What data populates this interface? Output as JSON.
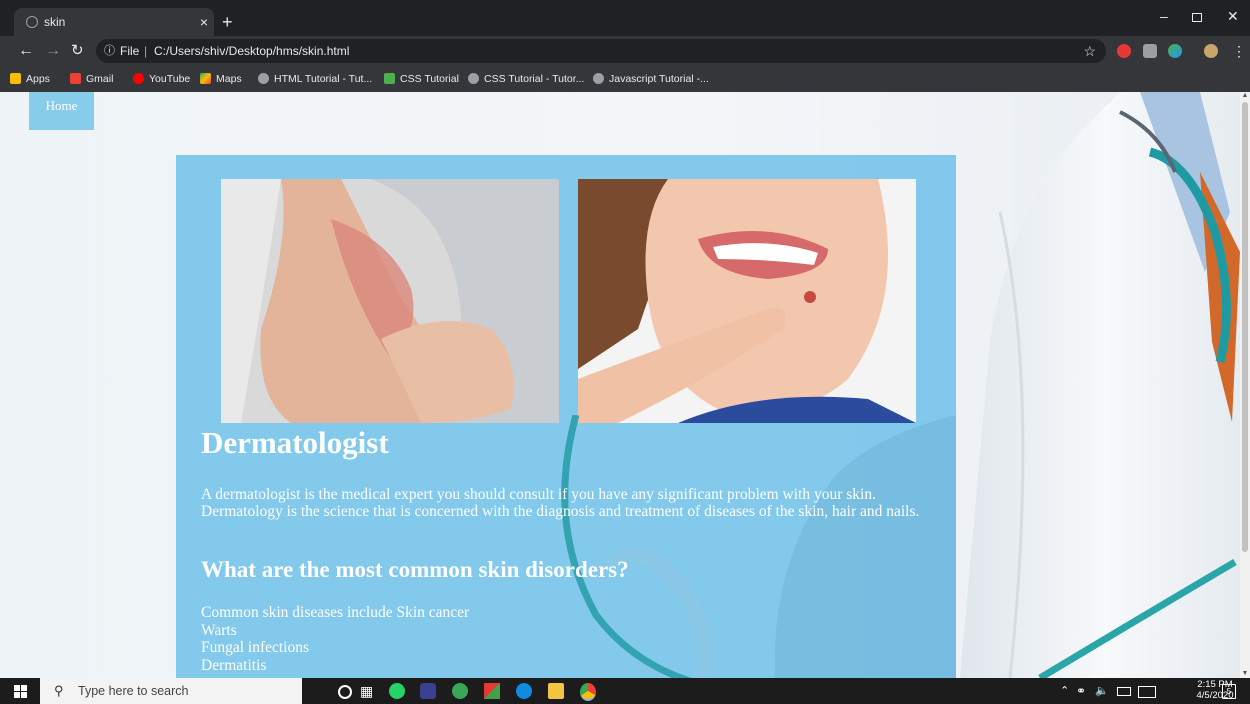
{
  "browser": {
    "tab_title": "skin",
    "tab_close": "×",
    "new_tab": "+",
    "address": {
      "scheme_label": "File",
      "separator": "|",
      "url": "C:/Users/shiv/Desktop/hms/skin.html"
    },
    "bookmarks": [
      {
        "label": "Apps",
        "icon": "apps-grid-icon",
        "color": "#fbbc05"
      },
      {
        "label": "Gmail",
        "icon": "gmail-icon",
        "color": "#ea4335"
      },
      {
        "label": "YouTube",
        "icon": "youtube-icon",
        "color": "#ff0000"
      },
      {
        "label": "Maps",
        "icon": "maps-icon",
        "color": "#34a853"
      },
      {
        "label": "HTML Tutorial - Tut...",
        "icon": "tutorial-icon",
        "color": "#9aa0a6"
      },
      {
        "label": "CSS Tutorial",
        "icon": "css-icon",
        "color": "#4caf50"
      },
      {
        "label": "CSS Tutorial - Tutor...",
        "icon": "tutorial-icon",
        "color": "#9aa0a6"
      },
      {
        "label": "Javascript Tutorial -...",
        "icon": "tutorial-icon",
        "color": "#9aa0a6"
      }
    ]
  },
  "page": {
    "nav": {
      "home_label": "Home"
    },
    "heading": "Dermatologist",
    "intro": "A dermatologist is the medical expert you should consult if you have any significant problem with your skin. Dermatology is the science that is concerned with the diagnosis and treatment of diseases of the skin, hair and nails.",
    "subheading": "What are the most common skin disorders?",
    "disorders": [
      "Common skin diseases include Skin cancer",
      "Warts",
      "Fungal infections",
      "Dermatitis"
    ],
    "colors": {
      "card": "#78c4ea",
      "home_button": "#87cdea",
      "text": "#ffffff"
    }
  },
  "taskbar": {
    "search_placeholder": "Type here to search",
    "time": "2:15 PM",
    "date": "4/5/2020",
    "notification_count": "5"
  }
}
